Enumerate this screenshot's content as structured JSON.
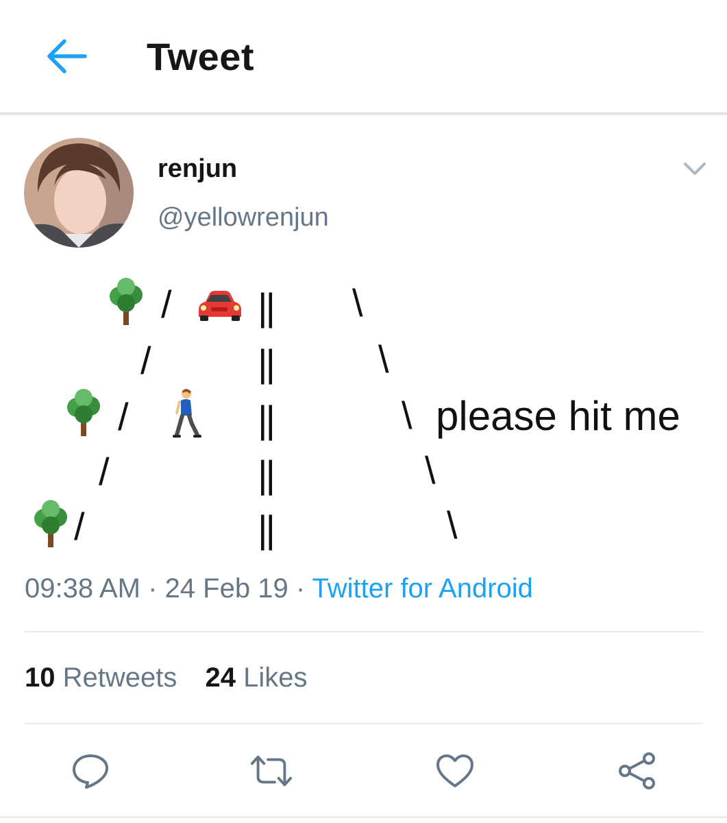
{
  "header": {
    "title": "Tweet",
    "back_icon": "back-arrow-icon",
    "accent": "#1da1f2"
  },
  "author": {
    "display_name": "renjun",
    "handle": "@yellowrenjun",
    "menu_icon": "chevron-down-icon"
  },
  "tweet": {
    "art": {
      "lines": [
        {
          "tree": true,
          "left_slash": "/",
          "car": true,
          "divider": "||",
          "right_slash": "\\"
        },
        {
          "left_slash": "/",
          "divider": "||",
          "right_slash": "\\"
        },
        {
          "tree": true,
          "left_slash": "/",
          "walker": true,
          "divider": "||",
          "right_slash": "\\"
        },
        {
          "left_slash": "/",
          "divider": "||",
          "right_slash": "\\"
        },
        {
          "tree": true,
          "left_slash": "/",
          "divider": "||",
          "right_slash": "\\"
        }
      ],
      "emojis": [
        "tree-emoji",
        "car-emoji",
        "person-walking-emoji"
      ]
    },
    "text": "please hit me"
  },
  "meta": {
    "time": "09:38 AM",
    "sep1": " · ",
    "date": "24 Feb 19",
    "sep2": " · ",
    "source": "Twitter for Android"
  },
  "stats": {
    "retweets_count": "10",
    "retweets_label": "Retweets",
    "likes_count": "24",
    "likes_label": "Likes"
  },
  "actions": [
    "reply-icon",
    "retweet-icon",
    "like-icon",
    "share-icon"
  ],
  "colors": {
    "text": "#14171a",
    "secondary": "#657786",
    "link": "#1da1f2",
    "divider": "#e6ecf0"
  }
}
